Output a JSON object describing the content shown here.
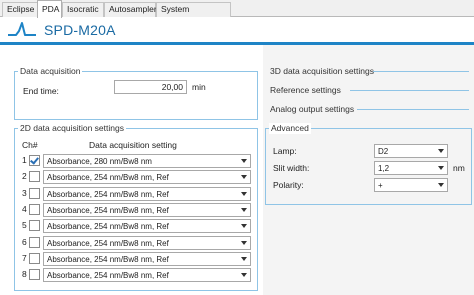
{
  "tabs": [
    "Eclipse",
    "PDA",
    "Isocratic",
    "Autosampler",
    "System Controller"
  ],
  "banner": {
    "title": "SPD-M20A",
    "logo_icon": "waveform-logo-icon"
  },
  "data_acquisition": {
    "title": "Data acquisition",
    "end_time_label": "End  time:",
    "end_time_value": "20,00",
    "end_time_unit": "min"
  },
  "acq2d": {
    "title": "2D data acquisition settings",
    "col_ch": "Ch#",
    "col_setting": "Data acquisition setting",
    "rows": [
      {
        "ch": "1",
        "checked": true,
        "setting": "Absorbance, 280 nm/Bw8 nm"
      },
      {
        "ch": "2",
        "checked": false,
        "setting": "Absorbance, 254 nm/Bw8 nm, Ref"
      },
      {
        "ch": "3",
        "checked": false,
        "setting": "Absorbance, 254 nm/Bw8 nm, Ref"
      },
      {
        "ch": "4",
        "checked": false,
        "setting": "Absorbance, 254 nm/Bw8 nm, Ref"
      },
      {
        "ch": "5",
        "checked": false,
        "setting": "Absorbance, 254 nm/Bw8 nm, Ref"
      },
      {
        "ch": "6",
        "checked": false,
        "setting": "Absorbance, 254 nm/Bw8 nm, Ref"
      },
      {
        "ch": "7",
        "checked": false,
        "setting": "Absorbance, 254 nm/Bw8 nm, Ref"
      },
      {
        "ch": "8",
        "checked": false,
        "setting": "Absorbance, 254 nm/Bw8 nm, Ref"
      }
    ]
  },
  "sections": {
    "acq3d": "3D data acquisition settings",
    "reference": "Reference settings",
    "analog": "Analog output settings"
  },
  "advanced": {
    "title": "Advanced",
    "lamp_label": "Lamp:",
    "lamp_value": "D2",
    "slit_label": "Slit width:",
    "slit_value": "1,2",
    "slit_unit": "nm",
    "polarity_label": "Polarity:",
    "polarity_value": "+"
  },
  "colors": {
    "accent": "#1e84c6",
    "title": "#1a6aa3",
    "group_border": "#8fc4e6"
  }
}
